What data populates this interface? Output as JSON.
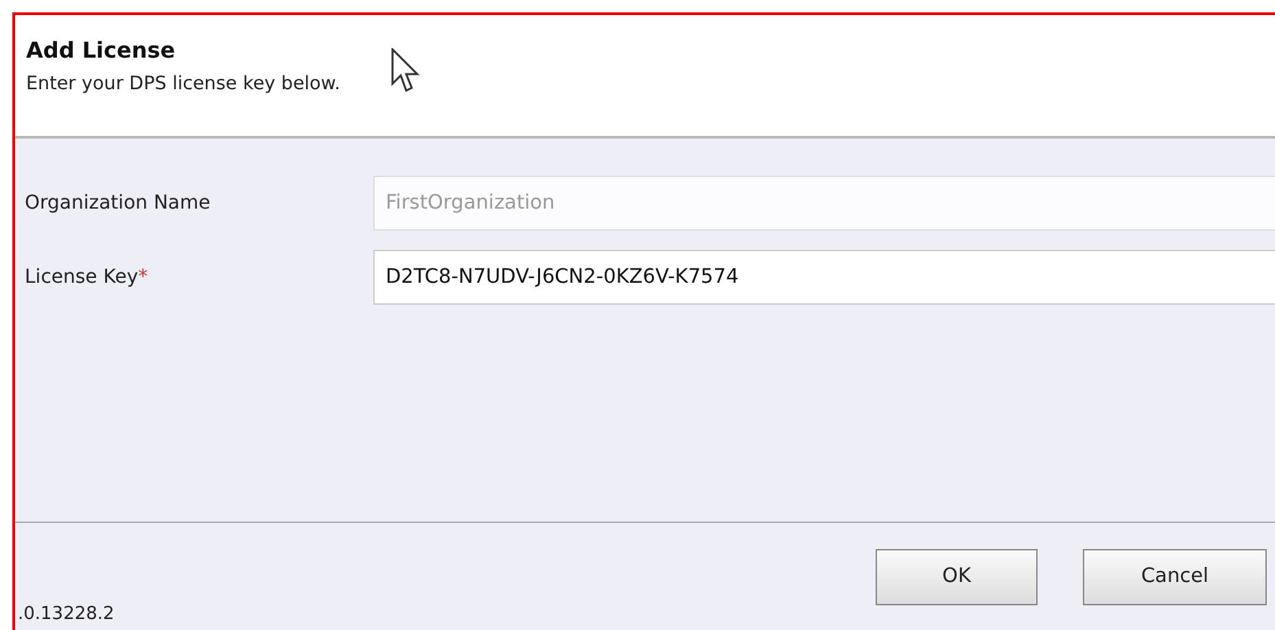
{
  "dialog": {
    "title": "Add License",
    "subtitle": "Enter your DPS license key below."
  },
  "fields": [
    {
      "label": "Organization Name",
      "value": "FirstOrganization",
      "disabled": true
    },
    {
      "label": "License Key",
      "value": "D2TC8-N7UDV-J6CN2-0KZ6V-K7574",
      "disabled": false,
      "required_mark": "*"
    }
  ],
  "buttons": [
    "OK",
    "Cancel"
  ],
  "version": ".0.13228.2"
}
